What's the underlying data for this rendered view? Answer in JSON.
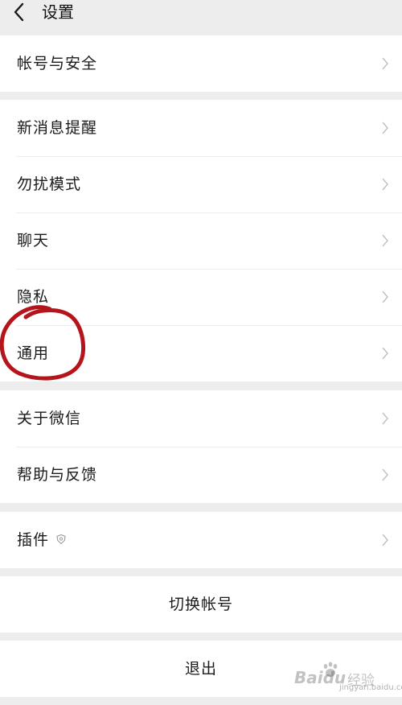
{
  "header": {
    "title": "设置"
  },
  "groups": {
    "account": {
      "items": [
        {
          "label": "帐号与安全"
        }
      ]
    },
    "main": {
      "items": [
        {
          "label": "新消息提醒"
        },
        {
          "label": "勿扰模式"
        },
        {
          "label": "聊天"
        },
        {
          "label": "隐私"
        },
        {
          "label": "通用"
        }
      ]
    },
    "about": {
      "items": [
        {
          "label": "关于微信"
        },
        {
          "label": "帮助与反馈"
        }
      ]
    },
    "plugins": {
      "items": [
        {
          "label": "插件",
          "icon": "plugin-shield-icon"
        }
      ]
    }
  },
  "actions": {
    "switch_account": "切换帐号",
    "logout": "退出"
  },
  "annotation": {
    "color": "#b5141b",
    "target": "通用"
  },
  "watermark": {
    "brand": "Baidu",
    "cn": "经验",
    "sub": "jingyan.baidu.com"
  },
  "colors": {
    "background": "#ededed",
    "row": "#ffffff",
    "text": "#1a1a1a",
    "chevron": "#c4c4c4"
  }
}
